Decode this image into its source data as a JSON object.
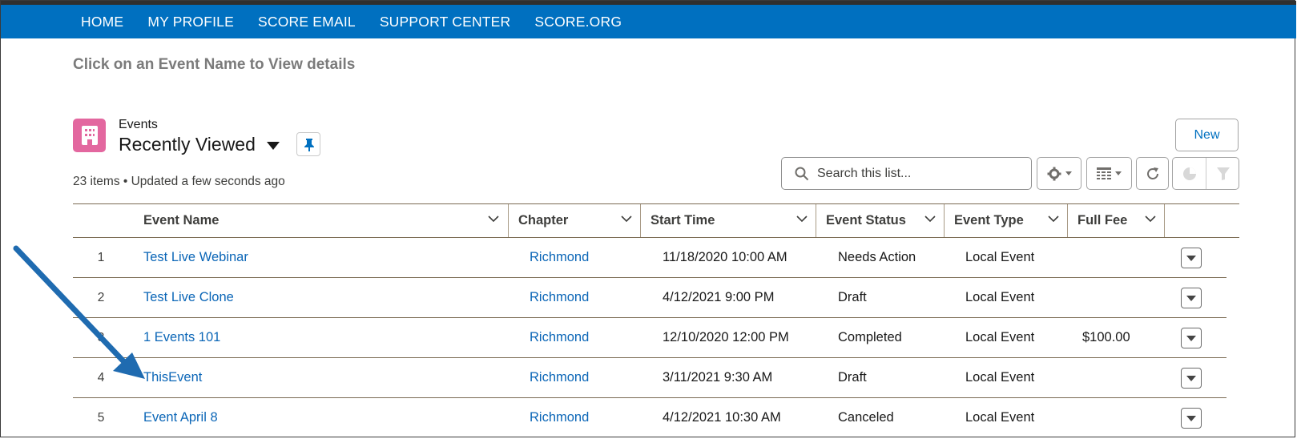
{
  "nav": {
    "items": [
      "HOME",
      "MY PROFILE",
      "SCORE EMAIL",
      "SUPPORT CENTER",
      "SCORE.ORG"
    ]
  },
  "hint": "Click on an Event Name to View details",
  "list": {
    "object_label": "Events",
    "view_name": "Recently Viewed",
    "meta": "23 items • Updated a few seconds ago",
    "new_label": "New",
    "search_placeholder": "Search this list..."
  },
  "icons": {
    "object": "building-icon",
    "pin": "pin-icon",
    "search": "search-icon",
    "settings": "gear-icon",
    "display": "table-view-icon",
    "refresh": "refresh-icon",
    "chart": "pie-chart-icon",
    "filter": "filter-icon"
  },
  "colors": {
    "nav_bg": "#0070c0",
    "link": "#0b66b7",
    "object_icon": "#e3679f",
    "annotation_arrow": "#1f6bb0"
  },
  "columns": [
    "Event Name",
    "Chapter",
    "Start Time",
    "Event Status",
    "Event Type",
    "Full Fee"
  ],
  "rows": [
    {
      "num": "1",
      "name": "Test Live Webinar",
      "chapter": "Richmond",
      "start": "11/18/2020 10:00 AM",
      "status": "Needs Action",
      "type": "Local Event",
      "fee": ""
    },
    {
      "num": "2",
      "name": "Test Live Clone",
      "chapter": "Richmond",
      "start": "4/12/2021 9:00 PM",
      "status": "Draft",
      "type": "Local Event",
      "fee": ""
    },
    {
      "num": "3",
      "name": "1 Events 101",
      "chapter": "Richmond",
      "start": "12/10/2020 12:00 PM",
      "status": "Completed",
      "type": "Local Event",
      "fee": "$100.00"
    },
    {
      "num": "4",
      "name": "ThisEvent",
      "chapter": "Richmond",
      "start": "3/11/2021 9:30 AM",
      "status": "Draft",
      "type": "Local Event",
      "fee": ""
    },
    {
      "num": "5",
      "name": "Event April 8",
      "chapter": "Richmond",
      "start": "4/12/2021 10:30 AM",
      "status": "Canceled",
      "type": "Local Event",
      "fee": ""
    }
  ]
}
